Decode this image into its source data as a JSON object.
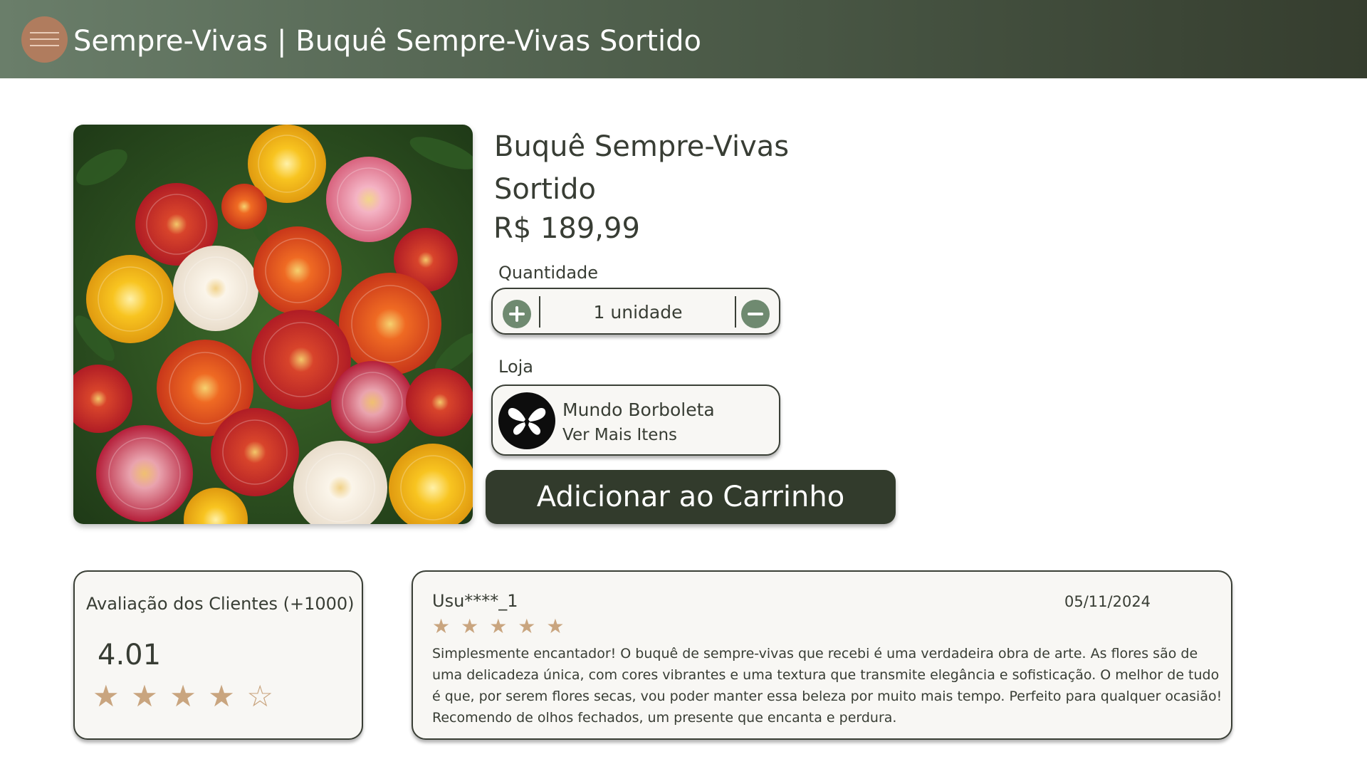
{
  "header": {
    "menu_icon": "hamburger-menu-icon",
    "title": "Sempre-Vivas | Buquê Sempre-Vivas Sortido"
  },
  "product": {
    "image": "bouquet-strawflowers-photo",
    "name": "Buquê Sempre-Vivas Sortido",
    "price": "R$ 189,99"
  },
  "quantity": {
    "label": "Quantidade",
    "value": "1 unidade",
    "increase_icon": "plus-circle-icon",
    "decrease_icon": "minus-circle-icon"
  },
  "store": {
    "label": "Loja",
    "name": "Mundo Borboleta",
    "link": "Ver Mais Itens",
    "logo_icon": "butterfly-icon"
  },
  "cart_button": "Adicionar ao Carrinho",
  "rating_summary": {
    "title": "Avaliação dos Clientes (+1000)",
    "score": "4.01",
    "stars": 4
  },
  "review": {
    "user": "Usu****_1",
    "date": "05/11/2024",
    "stars": 5,
    "text": "Simplesmente encantador! O buquê de sempre-vivas que recebi é uma verdadeira obra de arte. As flores são de uma delicadeza única, com cores vibrantes e uma textura que transmite elegância e sofisticação. O melhor de tudo é que, por serem flores secas, vou poder manter essa beleza por muito mais tempo. Perfeito para qualquer ocasião! Recomendo de olhos fechados, um presente que encanta e perdura."
  },
  "colors": {
    "header_start": "#6a7e6a",
    "header_end": "#353d2e",
    "accent_brown": "#b07c5e",
    "button_dark": "#323b2c",
    "stepper_green": "#6f8a70",
    "star": "#c9a57f"
  }
}
